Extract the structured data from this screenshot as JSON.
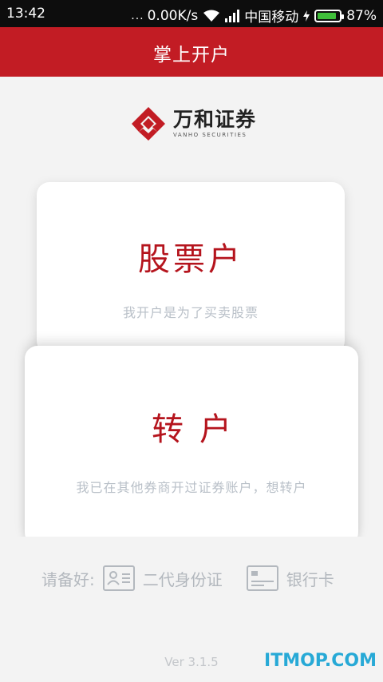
{
  "status_bar": {
    "time": "13:42",
    "dots": "...",
    "speed": "0.00K/s",
    "carrier": "中国移动",
    "battery": "87%",
    "battery_level": 0.87
  },
  "header": {
    "title": "掌上开户"
  },
  "logo": {
    "name_cn": "万和证券",
    "name_en": "VANHO SECURITIES",
    "brand_color": "#c21c24"
  },
  "cards": [
    {
      "title": "股票户",
      "subtitle": "我开户是为了买卖股票"
    },
    {
      "title": "转户",
      "subtitle": "我已在其他券商开过证券账户，想转户"
    }
  ],
  "prepare": {
    "label": "请备好:",
    "items": [
      {
        "icon": "id-card-icon",
        "label": "二代身份证"
      },
      {
        "icon": "bank-card-icon",
        "label": "银行卡"
      }
    ]
  },
  "version": "Ver 3.1.5",
  "watermark": "ITMOP.COM"
}
